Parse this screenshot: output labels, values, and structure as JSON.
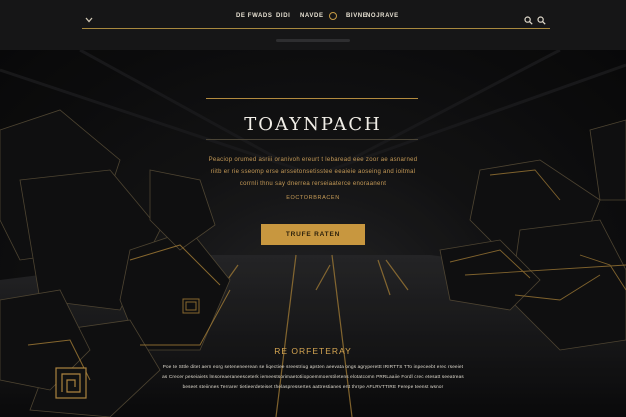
{
  "nav": {
    "links": [
      "DE FWADS",
      "DIDI",
      "NAVDE",
      "",
      "BIVNE",
      "NOJRAVE"
    ],
    "icons": {
      "menu": "chevron-down-icon",
      "logo": "ring-icon",
      "search": "search-icon",
      "search2": "search-icon"
    }
  },
  "hero": {
    "title": "TOAYNPACH",
    "description": "Peaciop orumed asriii oranivoh ereurt t lebaread eee zoor ae asnarned riitb er rie sseomp erse arssetonsetisstee eeaieie aoseing and ioitmal corrnli thnu say dnerrea rerseiaaterce enoraanent",
    "subtitle": "EOCTORBRACEN",
    "cta_label": "TRUFE RATEN"
  },
  "section": {
    "title": "RE ORFETERAY",
    "text": "Poe te Sttle ditet aern eorg seteneneerean se liqectiee sreestriug apsten aeevata ongs agryperettt IRIRTTS TTo inpeceebt erec rseeiet as Crecer peseiaiets lmsoreaeraneesceterk iemeestsorimaetotiiopoemmoerstiletens elotatcomn PRRLaaiie Fordl crec etesatt seeatreas beseet steiinnes Terrarer tietieerdeteiset thelaspressertes aattrestianes ertt thrrpe AFLRVTTIRE Ferepe teenst wsnor"
  },
  "colors": {
    "accent": "#c8973f",
    "background": "#0b0b0c",
    "text_gold": "#c59a57"
  }
}
